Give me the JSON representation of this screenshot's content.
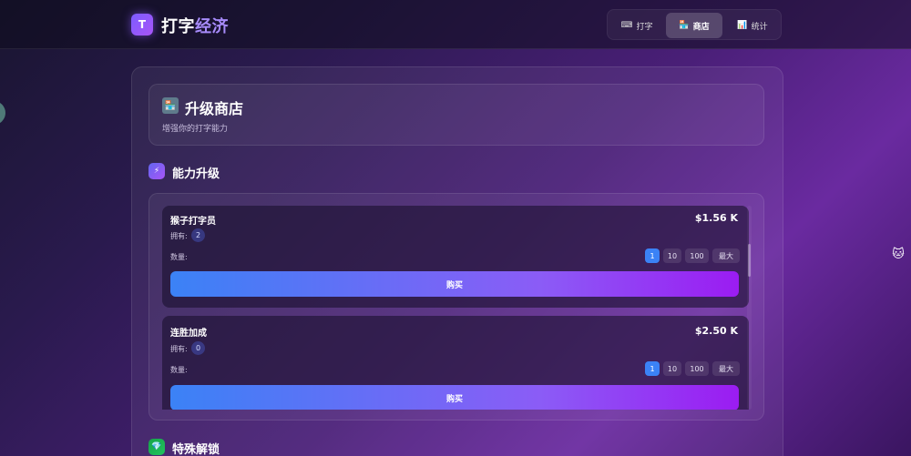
{
  "header": {
    "logo_letter": "T",
    "title_main": "打字",
    "title_accent": "经济",
    "nav": [
      {
        "icon": "⌨",
        "label": "打字",
        "active": false
      },
      {
        "icon": "🏪",
        "label": "商店",
        "active": true
      },
      {
        "icon": "📊",
        "label": "统计",
        "active": false
      }
    ]
  },
  "shop": {
    "icon": "🏪",
    "title": "升级商店",
    "subtitle": "增强你的打字能力"
  },
  "section_upgrades": {
    "icon": "⚡",
    "title": "能力升级",
    "icon_color": "#8b5cf6"
  },
  "section_unlocks": {
    "icon": "💎",
    "title": "特殊解锁",
    "icon_color": "#22c55e"
  },
  "upgrades": [
    {
      "name": "猴子打字员",
      "price": "$1.56 K",
      "owned_label": "拥有:",
      "owned": "2",
      "qty_label": "数量:",
      "qty_options": [
        "1",
        "10",
        "100",
        "最大"
      ],
      "selected_qty": "1",
      "buy_label": "购买"
    },
    {
      "name": "连胜加成",
      "price": "$2.50 K",
      "owned_label": "拥有:",
      "owned": "0",
      "qty_label": "数量:",
      "qty_options": [
        "1",
        "10",
        "100",
        "最大"
      ],
      "selected_qty": "1",
      "buy_label": "购买"
    }
  ],
  "colors": {
    "accent_blue": "#3b82f6",
    "accent_purple": "#8b5cf6"
  }
}
